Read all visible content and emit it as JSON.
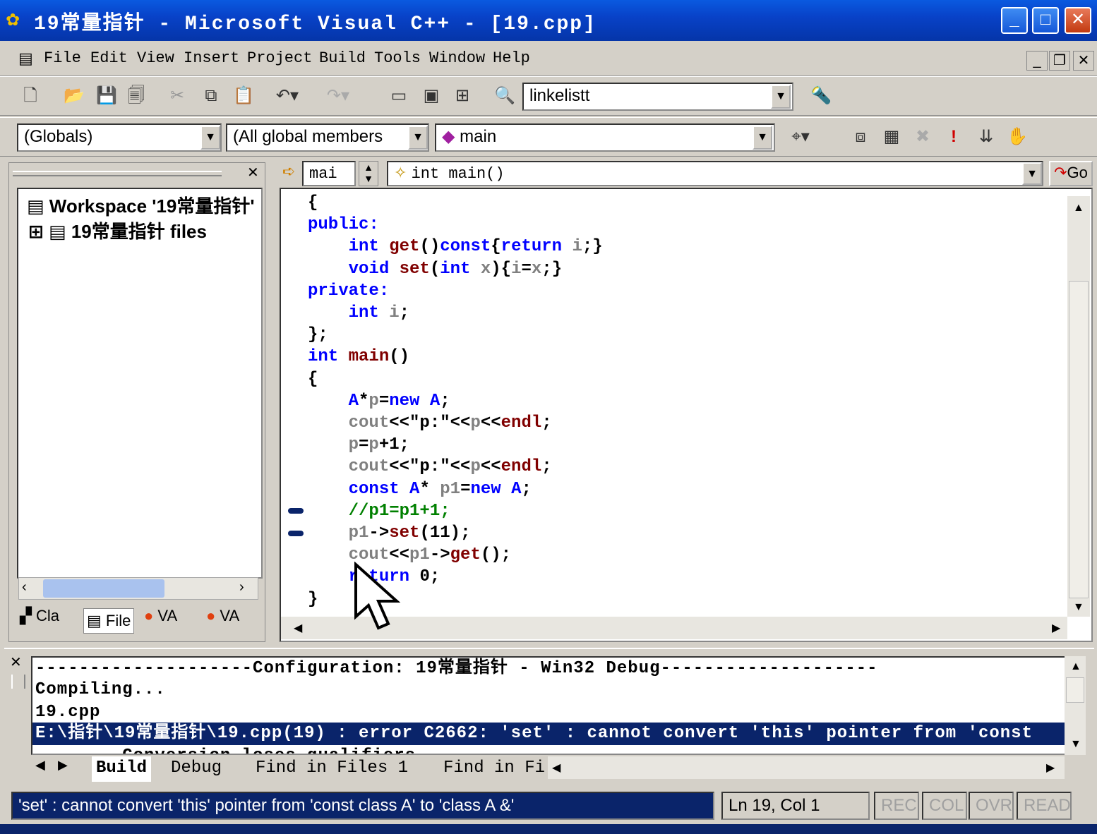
{
  "window": {
    "title": "19常量指针 - Microsoft Visual C++ - [19.cpp]"
  },
  "menu": [
    "File",
    "Edit",
    "View",
    "Insert",
    "Project",
    "Build",
    "Tools",
    "Window",
    "Help"
  ],
  "toolbar": {
    "config_combo": "linkelistt",
    "scope_combo": "(Globals)",
    "members_combo": "(All global members",
    "function_combo": "main",
    "go_label": "Go"
  },
  "editor_bar": {
    "nav_combo": "mai",
    "function_signature": "int main()"
  },
  "workspace": {
    "root": "Workspace '19常量指针'",
    "project": "19常量指针 files",
    "tabs": [
      "Cla",
      "File",
      "VA",
      "VA"
    ]
  },
  "code_lines": [
    [
      [
        "{",
        "pl"
      ]
    ],
    [
      [
        "public:",
        "kw"
      ]
    ],
    [
      [
        "    ",
        "pl"
      ],
      [
        "int ",
        "kw"
      ],
      [
        "get",
        "fn"
      ],
      [
        "()",
        "pl"
      ],
      [
        "const",
        "kw"
      ],
      [
        "{",
        "pl"
      ],
      [
        "return ",
        "kw"
      ],
      [
        "i",
        "id"
      ],
      [
        ";}",
        "pl"
      ]
    ],
    [
      [
        "    ",
        "pl"
      ],
      [
        "void ",
        "kw"
      ],
      [
        "set",
        "fn"
      ],
      [
        "(",
        "pl"
      ],
      [
        "int ",
        "kw"
      ],
      [
        "x",
        "id"
      ],
      [
        "){",
        "pl"
      ],
      [
        "i",
        "id"
      ],
      [
        "=",
        "pl"
      ],
      [
        "x",
        "id"
      ],
      [
        ";}",
        "pl"
      ]
    ],
    [
      [
        "private:",
        "kw"
      ]
    ],
    [
      [
        "    ",
        "pl"
      ],
      [
        "int ",
        "kw"
      ],
      [
        "i",
        "id"
      ],
      [
        ";",
        "pl"
      ]
    ],
    [
      [
        "};",
        "pl"
      ]
    ],
    [
      [
        "int ",
        "kw"
      ],
      [
        "main",
        "fn"
      ],
      [
        "()",
        "pl"
      ]
    ],
    [
      [
        "{",
        "pl"
      ]
    ],
    [
      [
        "    ",
        "pl"
      ],
      [
        "A",
        "kw"
      ],
      [
        "*",
        "pl"
      ],
      [
        "p",
        "id"
      ],
      [
        "=",
        "pl"
      ],
      [
        "new ",
        "kw"
      ],
      [
        "A",
        "kw"
      ],
      [
        ";",
        "pl"
      ]
    ],
    [
      [
        "    ",
        "pl"
      ],
      [
        "cout",
        "id"
      ],
      [
        "<<\"p:\"<<",
        "pl"
      ],
      [
        "p",
        "id"
      ],
      [
        "<<",
        "pl"
      ],
      [
        "endl",
        "fn"
      ],
      [
        ";",
        "pl"
      ]
    ],
    [
      [
        "    ",
        "pl"
      ],
      [
        "p",
        "id"
      ],
      [
        "=",
        "pl"
      ],
      [
        "p",
        "id"
      ],
      [
        "+1;",
        "pl"
      ]
    ],
    [
      [
        "    ",
        "pl"
      ],
      [
        "cout",
        "id"
      ],
      [
        "<<\"p:\"<<",
        "pl"
      ],
      [
        "p",
        "id"
      ],
      [
        "<<",
        "pl"
      ],
      [
        "endl",
        "fn"
      ],
      [
        ";",
        "pl"
      ]
    ],
    [
      [
        "    ",
        "pl"
      ],
      [
        "const ",
        "kw"
      ],
      [
        "A",
        "kw"
      ],
      [
        "* ",
        "pl"
      ],
      [
        "p1",
        "id"
      ],
      [
        "=",
        "pl"
      ],
      [
        "new ",
        "kw"
      ],
      [
        "A",
        "kw"
      ],
      [
        ";",
        "pl"
      ]
    ],
    [
      [
        "    ",
        "pl"
      ],
      [
        "//p1=p1+1;",
        "cm"
      ]
    ],
    [
      [
        "    ",
        "pl"
      ],
      [
        "p1",
        "id"
      ],
      [
        "->",
        "pl"
      ],
      [
        "set",
        "fn"
      ],
      [
        "(11);",
        "pl"
      ]
    ],
    [
      [
        "    ",
        "pl"
      ],
      [
        "cout",
        "id"
      ],
      [
        "<<",
        "pl"
      ],
      [
        "p1",
        "id"
      ],
      [
        "->",
        "pl"
      ],
      [
        "get",
        "fn"
      ],
      [
        "();",
        "pl"
      ]
    ],
    [
      [
        "    ",
        "pl"
      ],
      [
        "return ",
        "kw"
      ],
      [
        "0;",
        "pl"
      ]
    ],
    [
      [
        "}",
        "pl"
      ]
    ]
  ],
  "output": {
    "lines": [
      "--------------------Configuration: 19常量指针 - Win32 Debug--------------------",
      "Compiling...",
      "19.cpp"
    ],
    "error_line": "E:\\指针\\19常量指针\\19.cpp(19) : error C2662: 'set' : cannot convert 'this' pointer from 'const",
    "partial_line": "        Conversion loses qualifiers",
    "tabs": [
      "Build",
      "Debug",
      "Find in Files 1",
      "Find in Fi"
    ]
  },
  "status": {
    "message": "'set' : cannot convert 'this' pointer from 'const class A' to 'class A &'",
    "position": "Ln 19, Col 1",
    "indicators": [
      "REC",
      "COL",
      "OVR",
      "READ"
    ]
  },
  "colors": {
    "title_bar": "#0842c8",
    "status_message_bg": "#0a246a",
    "keyword": "#0000ff",
    "error_highlight": "#0a246a"
  }
}
